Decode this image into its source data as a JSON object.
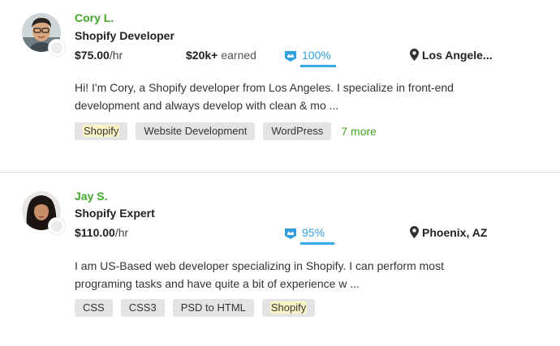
{
  "colors": {
    "name_green": "#41a62a",
    "accent_blue": "#37a8e6",
    "tag_bg": "#e4e4e4",
    "highlight": "#fbf5c6"
  },
  "freelancers": [
    {
      "name": "Cory L.",
      "title": "Shopify Developer",
      "rate": "$75.00",
      "rate_unit": "/hr",
      "earned": "$20k+",
      "earned_label": "earned",
      "jss_icon": "top-rated-badge-icon",
      "jss": "100%",
      "jss_fraction": 1.0,
      "location": "Los Angele...",
      "location_icon": "map-pin-icon",
      "description_line1": "Hi! I'm Cory, a Shopify developer from Los Angeles. I specialize in front-end",
      "description_line2": "development and always develop with clean & mo ...",
      "tags": [
        "Shopify",
        "Website Development",
        "WordPress"
      ],
      "more": "7 more"
    },
    {
      "name": "Jay S.",
      "title": "Shopify Expert",
      "rate": "$110.00",
      "rate_unit": "/hr",
      "jss_icon": "top-rated-badge-icon",
      "jss": "95%",
      "jss_fraction": 0.95,
      "location": "Phoenix, AZ",
      "location_icon": "map-pin-icon",
      "description_line1": "I am US-Based web developer specializing in Shopify. I can perform most",
      "description_line2": "programing tasks and have quite a bit of experience w ...",
      "tags": [
        "CSS",
        "CSS3",
        "PSD to HTML",
        "Shopify"
      ]
    }
  ]
}
